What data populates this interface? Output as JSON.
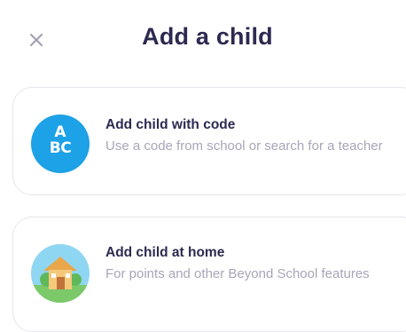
{
  "header": {
    "close_icon": "close-icon",
    "title": "Add a child"
  },
  "options": [
    {
      "title": "Add child with code",
      "description": "Use a code from school or search for a teacher",
      "icon": "abc-icon",
      "icon_letters_top": "A",
      "icon_letters_bottom": "BC",
      "icon_color": "#1da1e7"
    },
    {
      "title": "Add child at home",
      "description": "For points and other Beyond School features",
      "icon": "house-icon",
      "icon_color": "#8fd6f2"
    }
  ],
  "colors": {
    "title_text": "#2c2a50",
    "secondary_text": "#a8a6b8",
    "card_border": "#e6e6ee"
  }
}
